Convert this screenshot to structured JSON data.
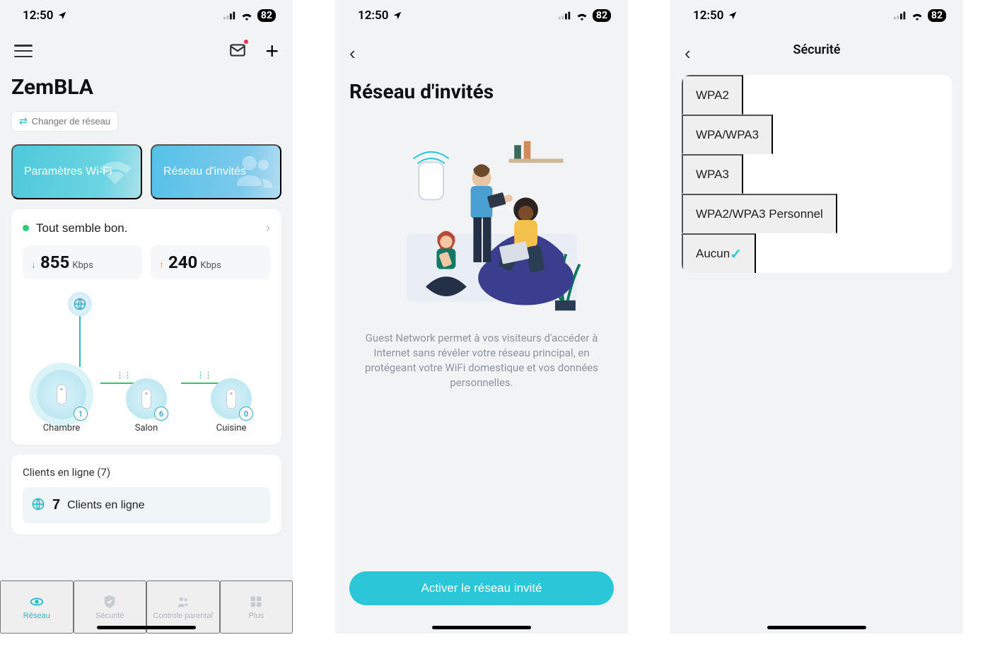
{
  "statusbar": {
    "time": "12:50",
    "battery": "82"
  },
  "screen1": {
    "title": "ZemBLA",
    "change_network": "Changer de réseau",
    "wifi_card": "Paramètres Wi-Fi",
    "guest_card": "Réseau d'invités",
    "status_text": "Tout semble bon.",
    "down_value": "855",
    "down_unit": "Kbps",
    "up_value": "240",
    "up_unit": "Kbps",
    "nodes": [
      {
        "label": "Chambre",
        "badge": "1"
      },
      {
        "label": "Salon",
        "badge": "6"
      },
      {
        "label": "Cuisine",
        "badge": "0"
      }
    ],
    "clients_title": "Clients en ligne (7)",
    "clients_count": "7",
    "clients_label": "Clients en ligne",
    "nav": {
      "reseau": "Réseau",
      "securite": "Sécurité",
      "parental": "Controle parental",
      "plus": "Plus"
    }
  },
  "screen2": {
    "title": "Réseau d'invités",
    "desc": "Guest Network permet à vos visiteurs d'accéder à Internet sans révéler votre réseau principal, en protégeant votre WiFi domestique et vos données personnelles.",
    "cta": "Activer le réseau invité"
  },
  "screen3": {
    "title": "Sécurité",
    "options": [
      {
        "label": "WPA2",
        "selected": false
      },
      {
        "label": "WPA/WPA3",
        "selected": false
      },
      {
        "label": "WPA3",
        "selected": false
      },
      {
        "label": "WPA2/WPA3 Personnel",
        "selected": false
      },
      {
        "label": "Aucun",
        "selected": true
      }
    ]
  }
}
